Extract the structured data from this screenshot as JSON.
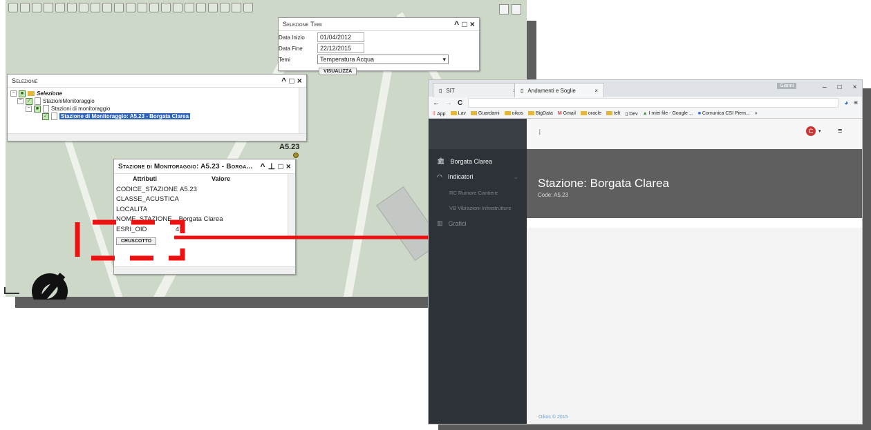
{
  "gis": {
    "theme_panel": {
      "title": "Selezione Temi",
      "date_start_label": "Data Inizio",
      "date_start_value": "01/04/2012",
      "date_end_label": "Data Fine",
      "date_end_value": "22/12/2015",
      "theme_label": "Temi",
      "theme_value": "Temperatura Acqua",
      "show_button": "VISUALIZZA"
    },
    "selection_panel": {
      "title": "Selezione",
      "tree": [
        {
          "label": "Selezione"
        },
        {
          "label": "StazioniMonitoraggio"
        },
        {
          "label": "Stazioni di monitoraggio"
        },
        {
          "label": "Stazione di Monitoraggio: A5.23 - Borgata Clarea"
        }
      ]
    },
    "map_label": "A5.23",
    "station_panel": {
      "title": "Stazione di Monitoraggio: A5.23 - Borga...",
      "col_attr": "Attributi",
      "col_value": "Valore",
      "rows": [
        {
          "k": "CODICE_STAZIONE",
          "v": "A5.23"
        },
        {
          "k": "CLASSE_ACUSTICA",
          "v": ""
        },
        {
          "k": "LOCALITA",
          "v": ""
        },
        {
          "k": "NOME_STAZIONE",
          "v": "Borgata Clarea"
        },
        {
          "k": "ESRI_OID",
          "v": "41"
        }
      ],
      "dashboard_button": "CRUSCOTTO"
    }
  },
  "browser": {
    "tabs": [
      {
        "label": "SIT"
      },
      {
        "label": "Andamenti e Soglie"
      }
    ],
    "user_chip": "Gianni",
    "bookmarks": [
      "App",
      "Lav",
      "Guardami",
      "oikos",
      "BigData",
      "Gmail",
      "oracle",
      "telt",
      "Dev",
      "I miei file - Google ...",
      "Comunica CSI Piem...",
      "»"
    ],
    "app": {
      "nav": [
        {
          "label": "Borgata Clarea"
        },
        {
          "label": "Indicatori"
        },
        {
          "label": "RC Rumore Cantiere"
        },
        {
          "label": "VB Vibrazioni Infrastrutture"
        },
        {
          "label": "Grafici"
        }
      ],
      "hero_title": "Stazione: Borgata Clarea",
      "hero_code": "Code: A5.23",
      "footer": "Oikos © 2015"
    }
  },
  "colors": {
    "arrow": "#ee1111",
    "sidebar": "#2d3238",
    "hero": "#5f5f5f",
    "selection": "#2f63b6"
  }
}
